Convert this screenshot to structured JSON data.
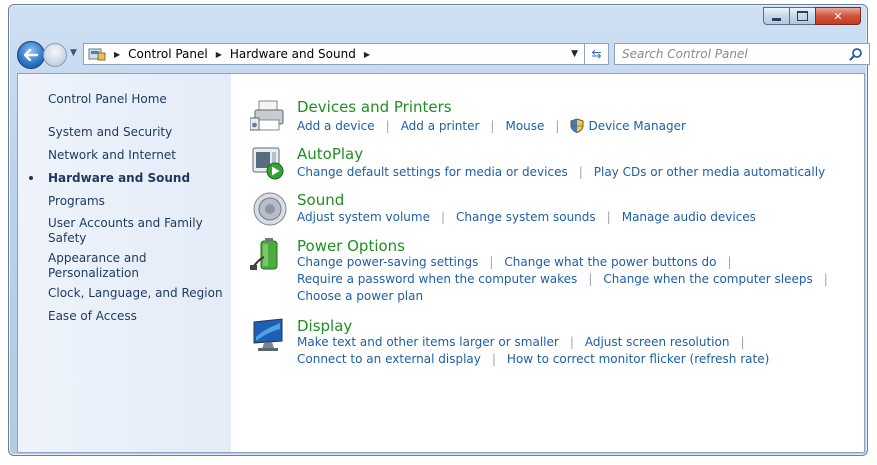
{
  "address": {
    "crumbs": [
      "Control Panel",
      "Hardware and Sound"
    ],
    "search_placeholder": "Search Control Panel"
  },
  "sidebar": {
    "items": [
      {
        "label": "Control Panel Home"
      },
      {
        "label": "System and Security"
      },
      {
        "label": "Network and Internet"
      },
      {
        "label": "Hardware and Sound",
        "active": true
      },
      {
        "label": "Programs"
      },
      {
        "label": "User Accounts and Family Safety"
      },
      {
        "label": "Appearance and Personalization"
      },
      {
        "label": "Clock, Language, and Region"
      },
      {
        "label": "Ease of Access"
      }
    ]
  },
  "categories": [
    {
      "title": "Devices and Printers",
      "icon": "printer-icon",
      "lines": [
        [
          "Add a device",
          "Add a printer",
          "Mouse",
          "Device Manager"
        ]
      ]
    },
    {
      "title": "AutoPlay",
      "icon": "autoplay-icon",
      "lines": [
        [
          "Change default settings for media or devices",
          "Play CDs or other media automatically"
        ]
      ]
    },
    {
      "title": "Sound",
      "icon": "speaker-icon",
      "lines": [
        [
          "Adjust system volume",
          "Change system sounds",
          "Manage audio devices"
        ]
      ]
    },
    {
      "title": "Power Options",
      "icon": "power-battery-icon",
      "lines": [
        [
          "Change power-saving settings",
          "Change what the power buttons do"
        ],
        [
          "Require a password when the computer wakes",
          "Change when the computer sleeps"
        ],
        [
          "Choose a power plan"
        ]
      ]
    },
    {
      "title": "Display",
      "icon": "monitor-icon",
      "lines": [
        [
          "Make text and other items larger or smaller",
          "Adjust screen resolution"
        ],
        [
          "Connect to an external display",
          "How to correct monitor flicker (refresh rate)"
        ]
      ]
    }
  ]
}
